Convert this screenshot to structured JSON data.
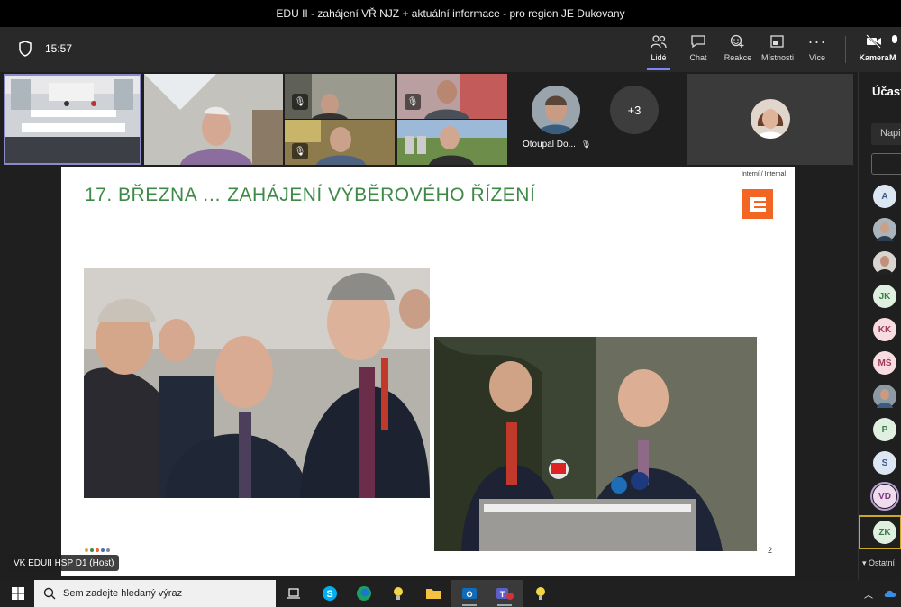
{
  "window": {
    "title": "EDU II - zahájení VŘ NJZ + aktuální informace - pro region JE Dukovany"
  },
  "toolbar": {
    "time": "15:57",
    "buttons": [
      {
        "label": "Lidé",
        "icon": "people-icon",
        "active": true
      },
      {
        "label": "Chat",
        "icon": "chat-icon"
      },
      {
        "label": "Reakce",
        "icon": "reaction-icon"
      },
      {
        "label": "Místnosti",
        "icon": "rooms-icon"
      },
      {
        "label": "Více",
        "icon": "more-icon"
      },
      {
        "label": "Kamera",
        "icon": "camera-icon"
      },
      {
        "label": "M",
        "icon": "mic-icon"
      }
    ]
  },
  "participants": {
    "named_tile": "Otoupal Do...",
    "more_count": "+3"
  },
  "slide": {
    "tag": "Interní / Internal",
    "title": "17. BŘEZNA … ZAHÁJENÍ VÝBĚROVÉHO ŘÍZENÍ",
    "page_number": "2",
    "brand_color": "#f26522",
    "title_color": "#3d8a47"
  },
  "host_label": "VK EDUII HSP D1 (Host)",
  "panel": {
    "title": "Účastníci",
    "search_placeholder": "Napište jméno",
    "avatars": [
      "A",
      "",
      "",
      "JK",
      "KK",
      "MŠ",
      "",
      "P",
      "S",
      "VD",
      "ZK"
    ],
    "others_label": "Ostatní"
  },
  "taskbar": {
    "search_placeholder": "Sem zadejte hledaný výraz"
  }
}
